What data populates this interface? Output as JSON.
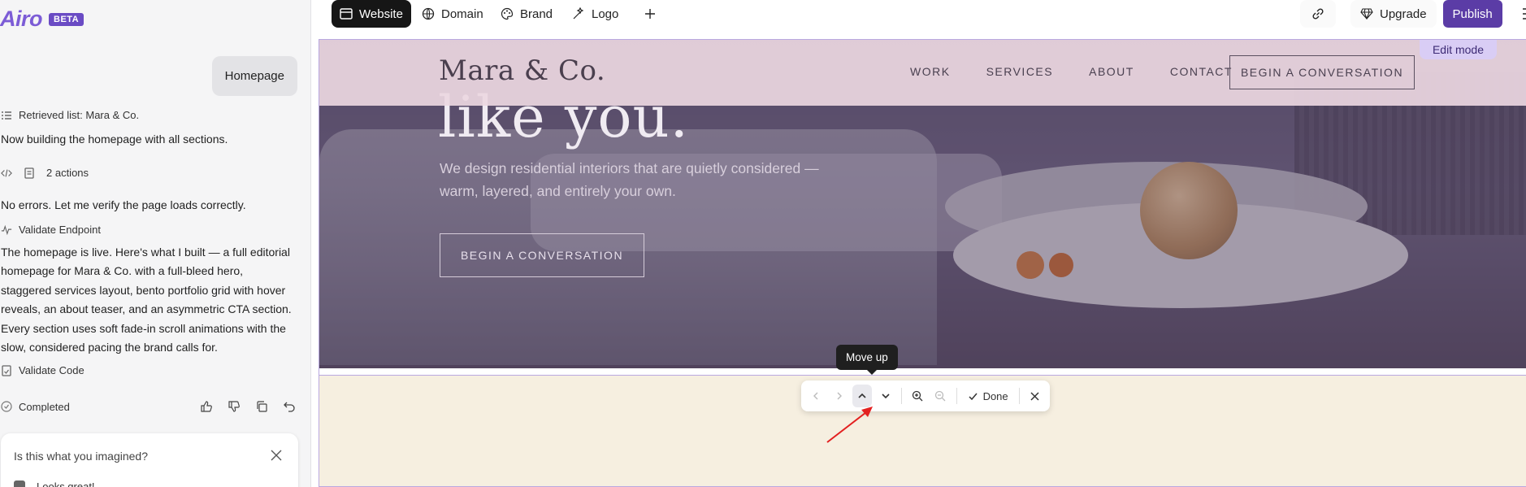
{
  "chat": {
    "logo": "Airo",
    "beta": "BETA",
    "user_message": "Homepage",
    "retrieved": "Retrieved list: Mara & Co.",
    "building": "Now building the homepage with all sections.",
    "actions": "2 actions",
    "no_errors": "No errors. Let me verify the page loads correctly.",
    "validate_endpoint": "Validate Endpoint",
    "summary_lines": [
      "The homepage is live. Here's what I built — a full editorial",
      "homepage for Mara & Co. with a full-bleed hero,",
      "staggered services layout, bento portfolio grid with hover",
      "reveals, an about teaser, and an asymmetric CTA section.",
      "Every section uses soft fade-in scroll animations with the",
      "slow, considered pacing the brand calls for."
    ],
    "validate_code": "Validate Code",
    "completed": "Completed",
    "feedback_question": "Is this what you imagined?",
    "feedback_option": "Looks great!"
  },
  "toolbar": {
    "website": "Website",
    "domain": "Domain",
    "brand": "Brand",
    "logo": "Logo",
    "upgrade": "Upgrade",
    "publish": "Publish"
  },
  "site": {
    "brand": "Mara & Co.",
    "nav": [
      "WORK",
      "SERVICES",
      "ABOUT",
      "CONTACT"
    ],
    "nav_cta": "BEGIN A CONVERSATION",
    "headline": "like you.",
    "subtitle_lines": [
      "We design residential interiors that are quietly considered —",
      "warm, layered, and entirely your own."
    ],
    "hero_cta": "BEGIN A CONVERSATION"
  },
  "editor": {
    "edit_mode": "Edit mode",
    "tooltip": "Move up",
    "done": "Done"
  },
  "colors": {
    "accent": "#5b3ca6",
    "selection_border": "#b9a8e0",
    "section_bg": "#f6efe0"
  }
}
